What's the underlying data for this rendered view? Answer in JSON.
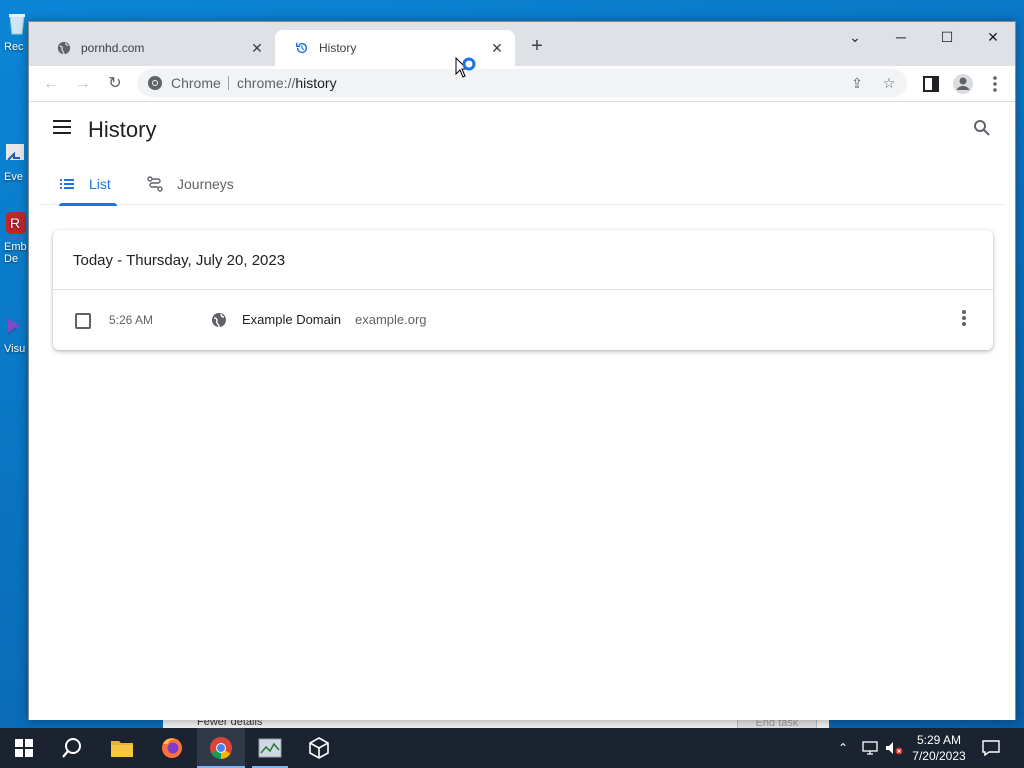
{
  "desktop": {
    "icons": [
      {
        "label": "Rec"
      },
      {
        "label": "Eve"
      },
      {
        "label": "Emb\nDe"
      },
      {
        "label": "Visu"
      }
    ],
    "behind_window": {
      "fewer_details": "Fewer details",
      "end_task": "End task"
    }
  },
  "browser": {
    "tabs": [
      {
        "title": "pornhd.com",
        "active": false
      },
      {
        "title": "History",
        "active": true
      }
    ],
    "omnibox": {
      "chrome_label": "Chrome",
      "scheme": "chrome://",
      "path": "history"
    }
  },
  "history_page": {
    "title": "History",
    "tabs": [
      {
        "label": "List",
        "selected": true
      },
      {
        "label": "Journeys",
        "selected": false
      }
    ],
    "date_heading": "Today - Thursday, July 20, 2023",
    "entries": [
      {
        "time": "5:26 AM",
        "title": "Example Domain",
        "domain": "example.org"
      }
    ]
  },
  "taskbar": {
    "clock_time": "5:29 AM",
    "clock_date": "7/20/2023"
  },
  "colors": {
    "accent": "#1a73e8",
    "taskbar": "#1c2330",
    "desktop": "#0a78c8"
  }
}
